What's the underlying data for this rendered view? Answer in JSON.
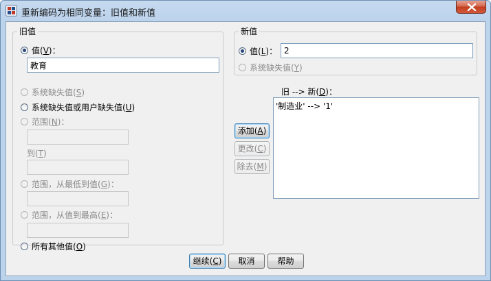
{
  "window": {
    "title": "重新编码为相同变量：旧值和新值"
  },
  "old_value": {
    "group_label": "旧值",
    "value_option": {
      "label": "值",
      "key": "V",
      "suffix": "："
    },
    "value_input": "教育",
    "system_missing": {
      "label": "系统缺失值",
      "key": "S"
    },
    "system_or_user_missing": {
      "label": "系统缺失值或用户缺失值",
      "key": "U"
    },
    "range": {
      "label": "范围",
      "key": "N",
      "suffix": "："
    },
    "to": {
      "label": "到",
      "key": "T"
    },
    "range_lowest": {
      "label": "范围，从最低到值",
      "key": "G",
      "suffix": "："
    },
    "range_highest": {
      "label": "范围，从值到最高",
      "key": "E",
      "suffix": "："
    },
    "all_other": {
      "label": "所有其他值",
      "key": "O"
    }
  },
  "new_value": {
    "group_label": "新值",
    "value_option": {
      "label": "值",
      "key": "L",
      "suffix": "："
    },
    "value_input": "2",
    "system_missing": {
      "label": "系统缺失值",
      "key": "Y"
    }
  },
  "mapping": {
    "header": {
      "label": "旧 --> 新",
      "key": "D",
      "suffix": "："
    },
    "items": [
      "'制造业' --> '1'"
    ]
  },
  "mapping_buttons": {
    "add": {
      "label": "添加",
      "key": "A"
    },
    "change": {
      "label": "更改",
      "key": "C"
    },
    "remove": {
      "label": "除去",
      "key": "M"
    }
  },
  "footer": {
    "continue": {
      "label": "继续",
      "key": "C"
    },
    "cancel": {
      "label": "取消"
    },
    "help": {
      "label": "帮助"
    }
  }
}
